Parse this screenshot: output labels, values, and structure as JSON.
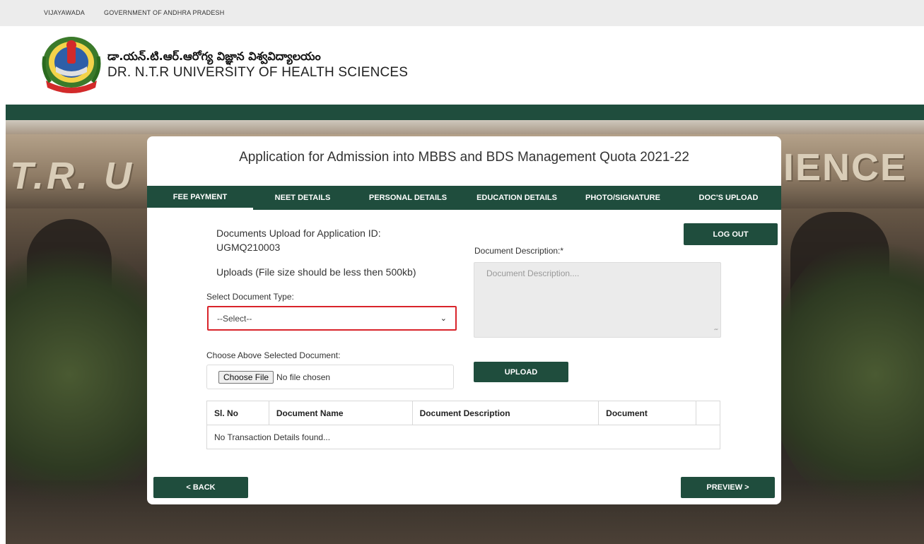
{
  "topbar": {
    "city": "VIJAYAWADA",
    "government": "GOVERNMENT OF ANDHRA PRADESH"
  },
  "header": {
    "university_telugu": "డా.యన్.టి.ఆర్.ఆరోగ్య విజ్ఞాన విశ్వవిద్యాలయం",
    "university_english": "DR. N.T.R UNIVERSITY OF HEALTH SCIENCES",
    "logo_icon": "university-seal-logo"
  },
  "colors": {
    "primary_green": "#1f4d3d",
    "error_border": "#d9242b"
  },
  "card": {
    "title": "Application for Admission into MBBS and BDS Management Quota 2021-22",
    "tabs": [
      {
        "label": "FEE PAYMENT",
        "active": true
      },
      {
        "label": "NEET DETAILS",
        "active": false
      },
      {
        "label": "PERSONAL DETAILS",
        "active": false
      },
      {
        "label": "EDUCATION DETAILS",
        "active": false
      },
      {
        "label": "PHOTO/SIGNATURE",
        "active": false
      },
      {
        "label": "DOC'S UPLOAD",
        "active": false
      }
    ]
  },
  "form": {
    "doc_title": "Documents Upload for Application ID:",
    "application_id": "UGMQ210003",
    "uploads_note": "Uploads (File size should be less then 500kb)",
    "select_label": "Select Document Type:",
    "select_value": "--Select--",
    "choose_label": "Choose Above Selected Document:",
    "file_button": "Choose File",
    "file_status": "No file chosen",
    "desc_label": "Document Description:*",
    "desc_placeholder": "Document Description....",
    "logout": "LOG OUT",
    "upload": "UPLOAD"
  },
  "table": {
    "headers": [
      "Sl. No",
      "Document Name",
      "Document Description",
      "Document",
      ""
    ],
    "empty_message": "No Transaction Details found..."
  },
  "footer": {
    "back": "< BACK",
    "preview": "PREVIEW >"
  },
  "background": {
    "building_text_left": "T.R.  U",
    "building_text_right": "IENCE"
  }
}
